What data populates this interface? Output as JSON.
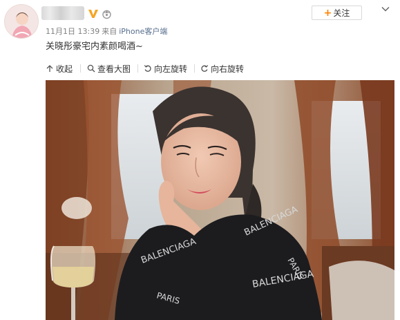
{
  "post": {
    "time": "11月1日 13:39",
    "source_prefix": "来自",
    "source": "iPhone客户端",
    "text": "关晓彤豪宅内素颜喝酒~"
  },
  "actions": {
    "follow_label": "关注"
  },
  "toolbar": {
    "collapse_label": "收起",
    "view_large_label": "查看大图",
    "rotate_left_label": "向左旋转",
    "rotate_right_label": "向右旋转"
  },
  "colors": {
    "accent": "#ff8200",
    "verified": "#f5a623",
    "link": "#556d8d"
  },
  "icons": [
    "avatar",
    "verified-badge",
    "level-icon",
    "chevron-down-icon",
    "collapse-icon",
    "magnifier-icon",
    "rotate-left-icon",
    "rotate-right-icon"
  ]
}
